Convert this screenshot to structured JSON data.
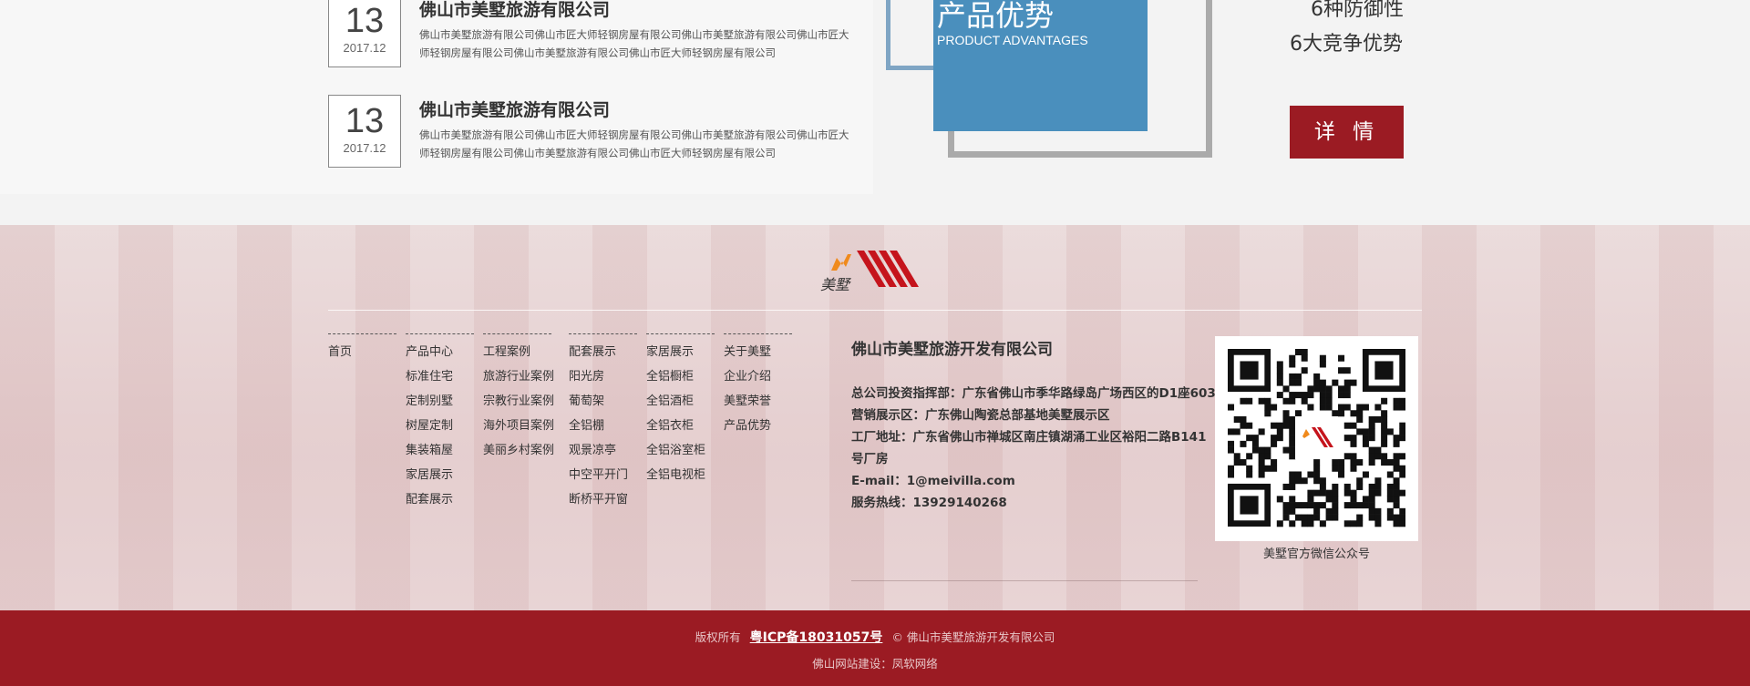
{
  "news": [
    {
      "day": "13",
      "ym": "2017.12",
      "title": "佛山市美墅旅游有限公司",
      "desc": "佛山市美墅旅游有限公司佛山市匠大师轻钢房屋有限公司佛山市美墅旅游有限公司佛山市匠大师轻钢房屋有限公司佛山市美墅旅游有限公司佛山市匠大师轻钢房屋有限公司"
    },
    {
      "day": "13",
      "ym": "2017.12",
      "title": "佛山市美墅旅游有限公司",
      "desc": "佛山市美墅旅游有限公司佛山市匠大师轻钢房屋有限公司佛山市美墅旅游有限公司佛山市匠大师轻钢房屋有限公司佛山市美墅旅游有限公司佛山市匠大师轻钢房屋有限公司"
    }
  ],
  "advantages": {
    "title": "产品优势",
    "subtitle": "PRODUCT ADVANTAGES",
    "line1": "6种防御性",
    "line2": "6大竞争优势",
    "detail_button": "详 情"
  },
  "logo": {
    "text": "美墅"
  },
  "nav": [
    {
      "items": [
        "首页"
      ]
    },
    {
      "items": [
        "产品中心",
        "标准住宅",
        "定制别墅",
        "树屋定制",
        "集装箱屋",
        "家居展示",
        "配套展示"
      ]
    },
    {
      "items": [
        "工程案例",
        "旅游行业案例",
        "宗教行业案例",
        "海外项目案例",
        "美丽乡村案例"
      ]
    },
    {
      "items": [
        "配套展示",
        "阳光房",
        "葡萄架",
        "全铝棚",
        "观景凉亭",
        "中空平开门",
        "断桥平开窗"
      ]
    },
    {
      "items": [
        "家居展示",
        "全铝橱柜",
        "全铝酒柜",
        "全铝衣柜",
        "全铝浴室柜",
        "全铝电视柜"
      ]
    },
    {
      "items": [
        "关于美墅",
        "企业介绍",
        "美墅荣誉",
        "产品优势"
      ]
    }
  ],
  "company": {
    "name": "佛山市美墅旅游开发有限公司",
    "contacts": [
      "总公司投资指挥部：广东省佛山市季华路绿岛广场西区的D1座603",
      "营销展示区：广东佛山陶瓷总部基地美墅展示区",
      "工厂地址：广东省佛山市禅城区南庄镇湖涌工业区裕阳二路B141号厂房",
      "E-mail：1@meivilla.com",
      "服务热线：13929140268"
    ]
  },
  "qr": {
    "label": "美墅官方微信公众号"
  },
  "bottom": {
    "copyright_prefix": "版权所有",
    "icp": "粤ICP备18031057号",
    "copyright_suffix": "© 佛山市美墅旅游开发有限公司",
    "builder": "佛山网站建设：凤软网络"
  },
  "colors": {
    "brand_red": "#9b1b23",
    "advantage_blue": "#4a8fbd"
  }
}
